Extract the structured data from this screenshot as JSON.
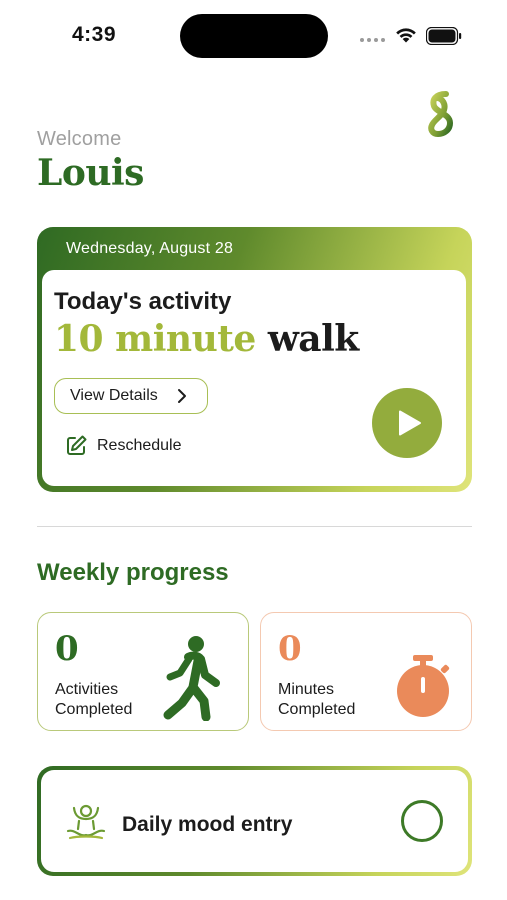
{
  "status_bar": {
    "time": "4:39",
    "icons": [
      "cellular-dots-icon",
      "wifi-icon",
      "battery-icon"
    ]
  },
  "header": {
    "welcome": "Welcome",
    "user_name": "Louis",
    "logo_icon": "brand-s-logo"
  },
  "activity": {
    "date": "Wednesday, August 28",
    "label": "Today's activity",
    "title_highlight": "10 minute",
    "title_rest": " walk",
    "view_details_label": "View Details",
    "reschedule_label": "Reschedule",
    "play_icon": "play-icon"
  },
  "weekly_progress": {
    "title": "Weekly progress",
    "stats": [
      {
        "value": "0",
        "label": "Activities Completed",
        "icon": "walking-person-icon",
        "color": "#2e6b24"
      },
      {
        "value": "0",
        "label": "Minutes Completed",
        "icon": "stopwatch-icon",
        "color": "#ea8a5a"
      }
    ]
  },
  "mood": {
    "label": "Daily mood entry",
    "icon": "meditation-figure-icon",
    "status_icon": "empty-ring-icon"
  },
  "colors": {
    "brand_green": "#2e6b24",
    "accent_lime": "#a3b83a",
    "play_green": "#93ac3d",
    "accent_orange": "#ea8a5a"
  }
}
